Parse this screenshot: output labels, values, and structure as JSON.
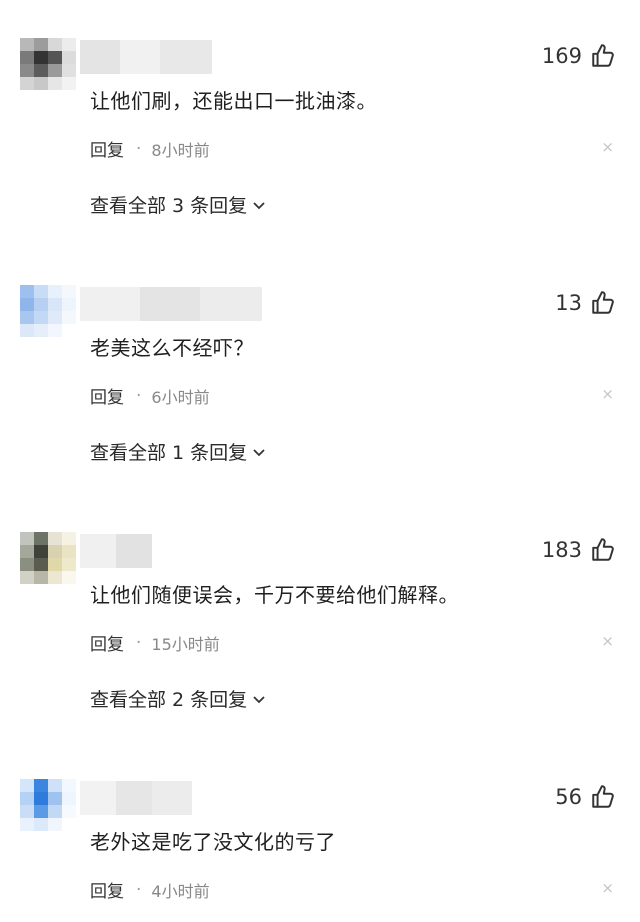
{
  "comments": [
    {
      "likes": "169",
      "text": "让他们刷，还能出口一批油漆。",
      "reply_label": "回复",
      "separator": "·",
      "time": "8小时前",
      "close_symbol": "×",
      "view_all": "查看全部 3 条回复"
    },
    {
      "likes": "13",
      "text": "老美这么不经吓？",
      "reply_label": "回复",
      "separator": "·",
      "time": "6小时前",
      "close_symbol": "×",
      "view_all": "查看全部 1 条回复"
    },
    {
      "likes": "183",
      "text": "让他们随便误会，千万不要给他们解释。",
      "reply_label": "回复",
      "separator": "·",
      "time": "15小时前",
      "close_symbol": "×",
      "view_all": "查看全部 2 条回复"
    },
    {
      "likes": "56",
      "text": "老外这是吃了没文化的亏了",
      "reply_label": "回复",
      "separator": "·",
      "time": "4小时前",
      "close_symbol": "×",
      "view_all": ""
    }
  ],
  "icons": {
    "like": "thumbs-up-icon",
    "close": "close-icon",
    "expand": "chevron-down-icon"
  },
  "colors": {
    "text": "#1f1f1f",
    "muted": "#888888",
    "close": "#c4c4c4"
  }
}
